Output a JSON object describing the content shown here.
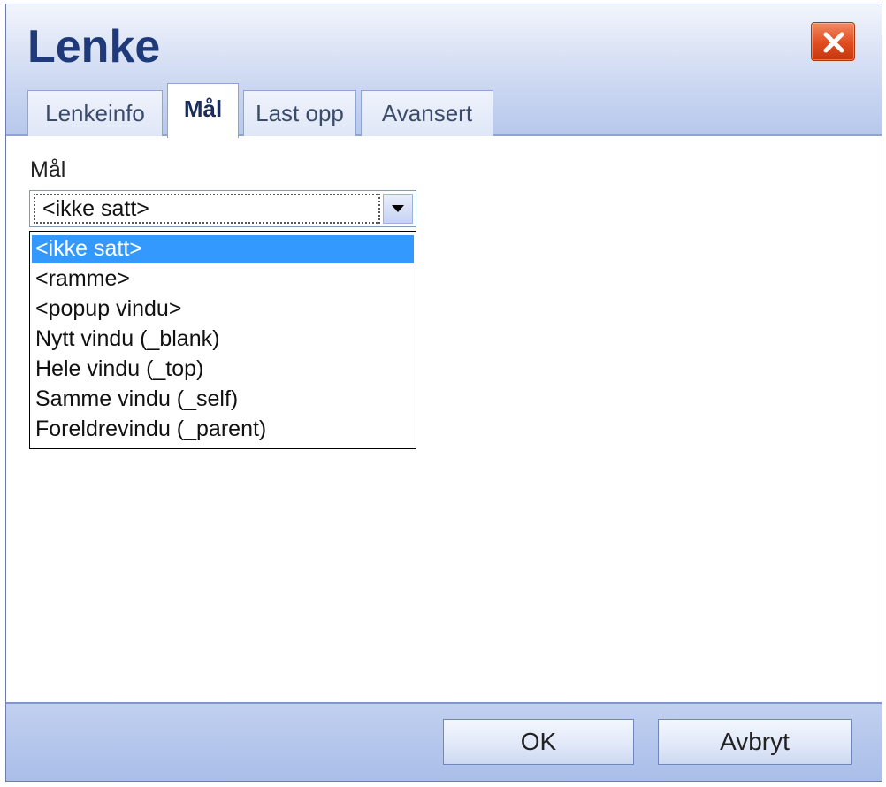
{
  "dialog": {
    "title": "Lenke",
    "close_icon": "close-icon"
  },
  "tabs": [
    {
      "label": "Lenkeinfo",
      "active": false
    },
    {
      "label": "Mål",
      "active": true
    },
    {
      "label": "Last opp",
      "active": false
    },
    {
      "label": "Avansert",
      "active": false
    }
  ],
  "target": {
    "label": "Mål",
    "selected_value": "<ikke satt>",
    "options": [
      "<ikke satt>",
      "<ramme>",
      "<popup vindu>",
      "Nytt vindu (_blank)",
      "Hele vindu (_top)",
      "Samme vindu (_self)",
      "Foreldrevindu (_parent)"
    ],
    "highlighted_index": 0
  },
  "buttons": {
    "ok_label": "OK",
    "cancel_label": "Avbryt"
  },
  "colors": {
    "title": "#1f3a7a",
    "close_button": "#e04c1e",
    "selection": "#3399ff",
    "footer": "#a9bde8"
  }
}
